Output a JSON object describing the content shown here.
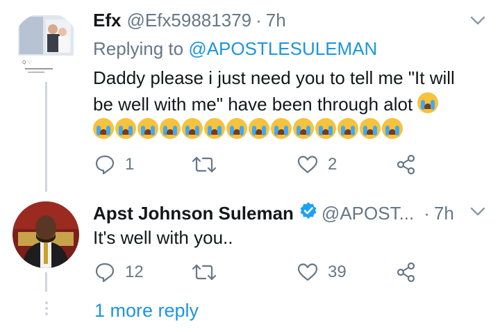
{
  "tweet1": {
    "name": "Efx",
    "handle": "@Efx59881379",
    "separator": "·",
    "time": "7h",
    "replying_prefix": "Replying to",
    "replying_to": "@APOSTLESULEMAN",
    "text_line1": "Daddy please i just need you to tell me \"It will",
    "text_line2": "be well with me\" have been through alot",
    "emoji_count_row": 14,
    "reply_count": "1",
    "retweet_count": "",
    "like_count": "2"
  },
  "tweet2": {
    "name": "Apst Johnson Suleman",
    "handle": "@APOST...",
    "separator": "·",
    "time": "7h",
    "text": "It's well with you..",
    "reply_count": "12",
    "retweet_count": "",
    "like_count": "39"
  },
  "more_reply": "1 more reply",
  "colors": {
    "link": "#1b95e0",
    "secondary": "#657786",
    "verified": "#1da1f2",
    "thread_line": "#ccd6dd"
  }
}
